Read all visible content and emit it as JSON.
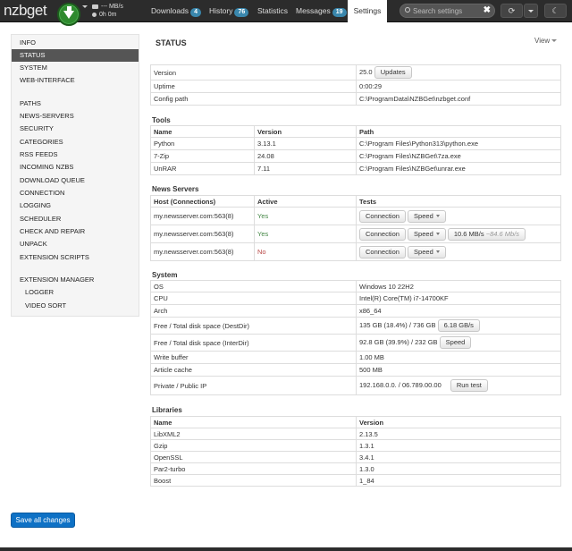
{
  "colors": {
    "navbar_bg": "#2c2c2c",
    "download_button": "#2e8a2e",
    "badge": "#3a87ad",
    "save_button": "#0e71c5",
    "active_status": "#468847",
    "inactive_status": "#b94a48"
  },
  "navbar": {
    "logo": "nzbget",
    "speed_text": "--- MB/s",
    "time_text": "0h 0m",
    "tabs": [
      {
        "label": "Downloads",
        "badge": "4"
      },
      {
        "label": "History",
        "badge": "76"
      },
      {
        "label": "Statistics",
        "badge": ""
      },
      {
        "label": "Messages",
        "badge": "19"
      },
      {
        "label": "Settings",
        "badge": ""
      }
    ],
    "search_placeholder": "Search settings",
    "icons": [
      "download-icon",
      "speed-icon",
      "clock-icon",
      "search-icon",
      "close-icon",
      "refresh-icon",
      "chevron-down-icon",
      "theme-icon"
    ]
  },
  "sidebar": {
    "items": [
      "INFO",
      "STATUS",
      "SYSTEM",
      "WEB-INTERFACE",
      "PATHS",
      "NEWS-SERVERS",
      "SECURITY",
      "CATEGORIES",
      "RSS FEEDS",
      "INCOMING NZBS",
      "DOWNLOAD QUEUE",
      "CONNECTION",
      "LOGGING",
      "SCHEDULER",
      "CHECK AND REPAIR",
      "UNPACK",
      "EXTENSION SCRIPTS",
      "EXTENSION MANAGER",
      "LOGGER",
      "VIDEO SORT"
    ]
  },
  "main": {
    "title": "STATUS",
    "view_label": "View",
    "version": {
      "rows": [
        {
          "label": "Version",
          "value": "25.0",
          "button": "Updates"
        },
        {
          "label": "Uptime",
          "value": "0:00:29"
        },
        {
          "label": "Config path",
          "value": "C:\\ProgramData\\NZBGet\\nzbget.conf"
        }
      ]
    },
    "tools": {
      "title": "Tools",
      "headers": [
        "Name",
        "Version",
        "Path"
      ],
      "rows": [
        [
          "Python",
          "3.13.1",
          "C:\\Program Files\\Python313\\python.exe"
        ],
        [
          "7-Zip",
          "24.08",
          "C:\\Program Files\\NZBGet\\7za.exe"
        ],
        [
          "UnRAR",
          "7.11",
          "C:\\Program Files\\NZBGet\\unrar.exe"
        ]
      ]
    },
    "news_servers": {
      "title": "News Servers",
      "headers": [
        "Host (Connections)",
        "Active",
        "Tests"
      ],
      "connection_label": "Connection",
      "speed_label": "Speed",
      "rows": [
        {
          "host": "my.newsserver.com:563(8)",
          "active": "Yes",
          "result": ""
        },
        {
          "host": "my.newsserver.com:563(8)",
          "active": "Yes",
          "result": "10.6 MB/s",
          "result_extra": "~84.6 Mb/s"
        },
        {
          "host": "my.newsserver.com:563(8)",
          "active": "No",
          "result": ""
        }
      ]
    },
    "system": {
      "title": "System",
      "rows": [
        {
          "label": "OS",
          "value": "Windows 10 22H2"
        },
        {
          "label": "CPU",
          "value": "Intel(R) Core(TM) i7-14700KF"
        },
        {
          "label": "Arch",
          "value": "x86_64"
        },
        {
          "label": "Free / Total disk space (DestDir)",
          "value": "135 GB (18.4%) / 736 GB",
          "button": "6.18 GB/s"
        },
        {
          "label": "Free / Total disk space (InterDir)",
          "value": "92.8 GB (39.9%) / 232 GB",
          "button": "Speed"
        },
        {
          "label": "Write buffer",
          "value": "1.00 MB"
        },
        {
          "label": "Article cache",
          "value": "500 MB"
        },
        {
          "label": "Private / Public IP",
          "value": "192.168.0.0. / 06.789.00.00",
          "button": "Run test"
        }
      ]
    },
    "libraries": {
      "title": "Libraries",
      "headers": [
        "Name",
        "Version"
      ],
      "rows": [
        [
          "LibXML2",
          "2.13.5"
        ],
        [
          "Gzip",
          "1.3.1"
        ],
        [
          "OpenSSL",
          "3.4.1"
        ],
        [
          "Par2-turbo",
          "1.3.0"
        ],
        [
          "Boost",
          "1_84"
        ]
      ]
    }
  },
  "footer": {
    "save_label": "Save all changes"
  }
}
